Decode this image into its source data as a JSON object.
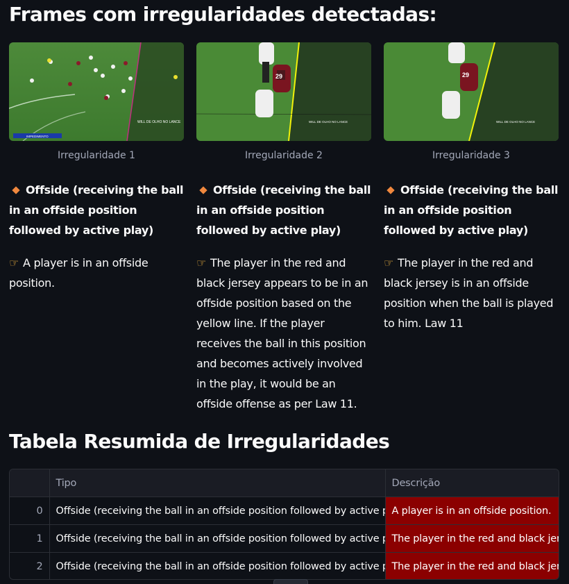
{
  "header": {
    "title": "Frames com irregularidades detectadas:"
  },
  "frames": [
    {
      "caption": "Irregularidade 1",
      "title": "Offside (receiving the ball in an offside position followed by active play)",
      "description": "A player is in an offside position.",
      "overlay_watermark": "WILL DE OLHO NO LANCE",
      "overlay_banner": "IMPEDIMENTO"
    },
    {
      "caption": "Irregularidade 2",
      "title": "Offside (receiving the ball in an offside position followed by active play)",
      "description": "The player in the red and black jersey appears to be in an offside position based on the yellow line. If the player receives the ball in this position and becomes actively involved in the play, it would be an offside offense as per Law 11.",
      "overlay_watermark": "WILL DE OLHO NO LANCE",
      "jersey_number": "29"
    },
    {
      "caption": "Irregularidade 3",
      "title": "Offside (receiving the ball in an offside position followed by active play)",
      "description": "The player in the red and black jersey is in an offside position when the ball is played to him. Law 11",
      "overlay_watermark": "WILL DE OLHO NO LANCE",
      "jersey_number": "29"
    }
  ],
  "summary": {
    "title": "Tabela Resumida de Irregularidades",
    "columns": [
      "",
      "Tipo",
      "Descrição"
    ],
    "rows": [
      {
        "index": "0",
        "tipo": "Offside (receiving the ball in an offside position followed by active play)",
        "descricao": "A player is in an offside position."
      },
      {
        "index": "1",
        "tipo": "Offside (receiving the ball in an offside position followed by active play)",
        "descricao": "The player in the red and black jersey appears to be in an offside position based on the yellow line. If the player receives the ball in this position and becomes actively involved in the play, it would be an offside offense as per Law 11."
      },
      {
        "index": "2",
        "tipo": "Offside (receiving the ball in an offside position followed by active play)",
        "descricao": "The player in the red and black jersey is in an offside position when the ball is played to him. Law 11"
      }
    ]
  },
  "colors": {
    "background": "#0e1117",
    "highlight_cell": "#8b0000",
    "offside_line": "#f2f20a",
    "accent_diamond": "#f0883e"
  }
}
